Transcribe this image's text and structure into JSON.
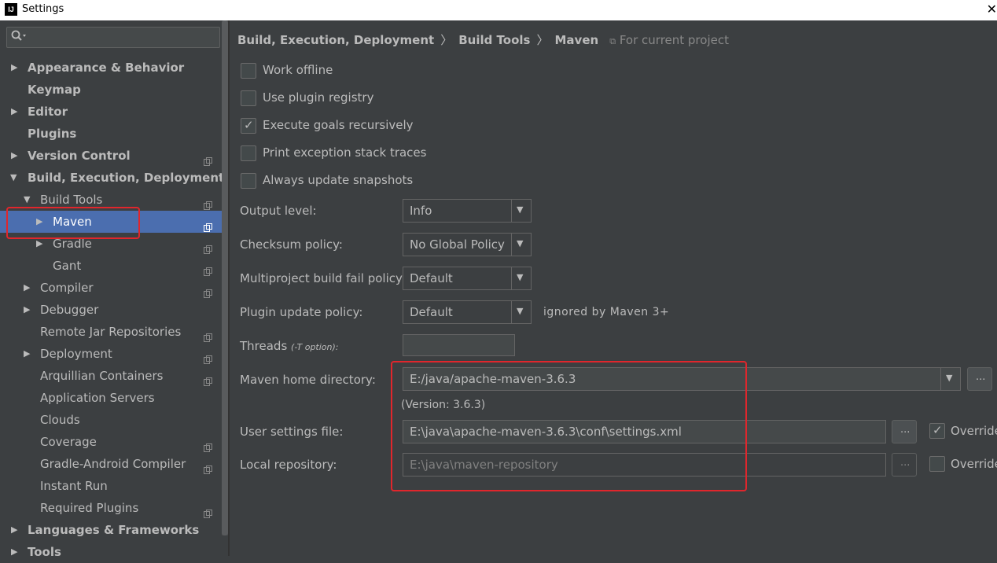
{
  "window": {
    "title": "Settings",
    "logo_text": "IJ",
    "close_glyph": "✕"
  },
  "sidebar": {
    "search_placeholder": "",
    "items": [
      {
        "label": "Appearance & Behavior",
        "bold": true
      },
      {
        "label": "Keymap",
        "bold": true
      },
      {
        "label": "Editor",
        "bold": true
      },
      {
        "label": "Plugins",
        "bold": true
      },
      {
        "label": "Version Control",
        "bold": true
      },
      {
        "label": "Build, Execution, Deployment",
        "bold": true
      },
      {
        "label": "Build Tools"
      },
      {
        "label": "Maven",
        "selected": true
      },
      {
        "label": "Gradle"
      },
      {
        "label": "Gant"
      },
      {
        "label": "Compiler"
      },
      {
        "label": "Debugger"
      },
      {
        "label": "Remote Jar Repositories"
      },
      {
        "label": "Deployment"
      },
      {
        "label": "Arquillian Containers"
      },
      {
        "label": "Application Servers"
      },
      {
        "label": "Clouds"
      },
      {
        "label": "Coverage"
      },
      {
        "label": "Gradle-Android Compiler"
      },
      {
        "label": "Instant Run"
      },
      {
        "label": "Required Plugins"
      },
      {
        "label": "Languages & Frameworks",
        "bold": true
      },
      {
        "label": "Tools",
        "bold": true
      }
    ]
  },
  "breadcrumb": {
    "part1": "Build, Execution, Deployment",
    "part2": "Build Tools",
    "part3": "Maven",
    "scope": "For current project"
  },
  "checkboxes": [
    {
      "label": "Work offline",
      "checked": false
    },
    {
      "label": "Use plugin registry",
      "checked": false
    },
    {
      "label": "Execute goals recursively",
      "checked": true
    },
    {
      "label": "Print exception stack traces",
      "checked": false
    },
    {
      "label": "Always update snapshots",
      "checked": false
    }
  ],
  "output_level": {
    "label": "Output level:",
    "value": "Info"
  },
  "checksum_policy": {
    "label": "Checksum policy:",
    "value": "No Global Policy"
  },
  "fail_policy": {
    "label": "Multiproject build fail policy:",
    "value": "Default"
  },
  "plugin_update_policy": {
    "label": "Plugin update policy:",
    "value": "Default",
    "note": "ignored by Maven 3+"
  },
  "threads": {
    "label": "Threads",
    "hint": "(-T option):",
    "value": ""
  },
  "maven_home": {
    "label": "Maven home directory:",
    "value": "E:/java/apache-maven-3.6.3",
    "version": "(Version: 3.6.3)"
  },
  "user_settings": {
    "label": "User settings file:",
    "value": "E:\\java\\apache-maven-3.6.3\\conf\\settings.xml",
    "override_label": "Override",
    "override_checked": true
  },
  "local_repo": {
    "label": "Local repository:",
    "value": "E:\\java\\maven-repository",
    "override_label": "Override",
    "override_checked": false
  },
  "browse_label": "...",
  "colors": {
    "selection": "#4b6eaf",
    "highlight": "#e0262c",
    "background": "#3c3f41"
  }
}
